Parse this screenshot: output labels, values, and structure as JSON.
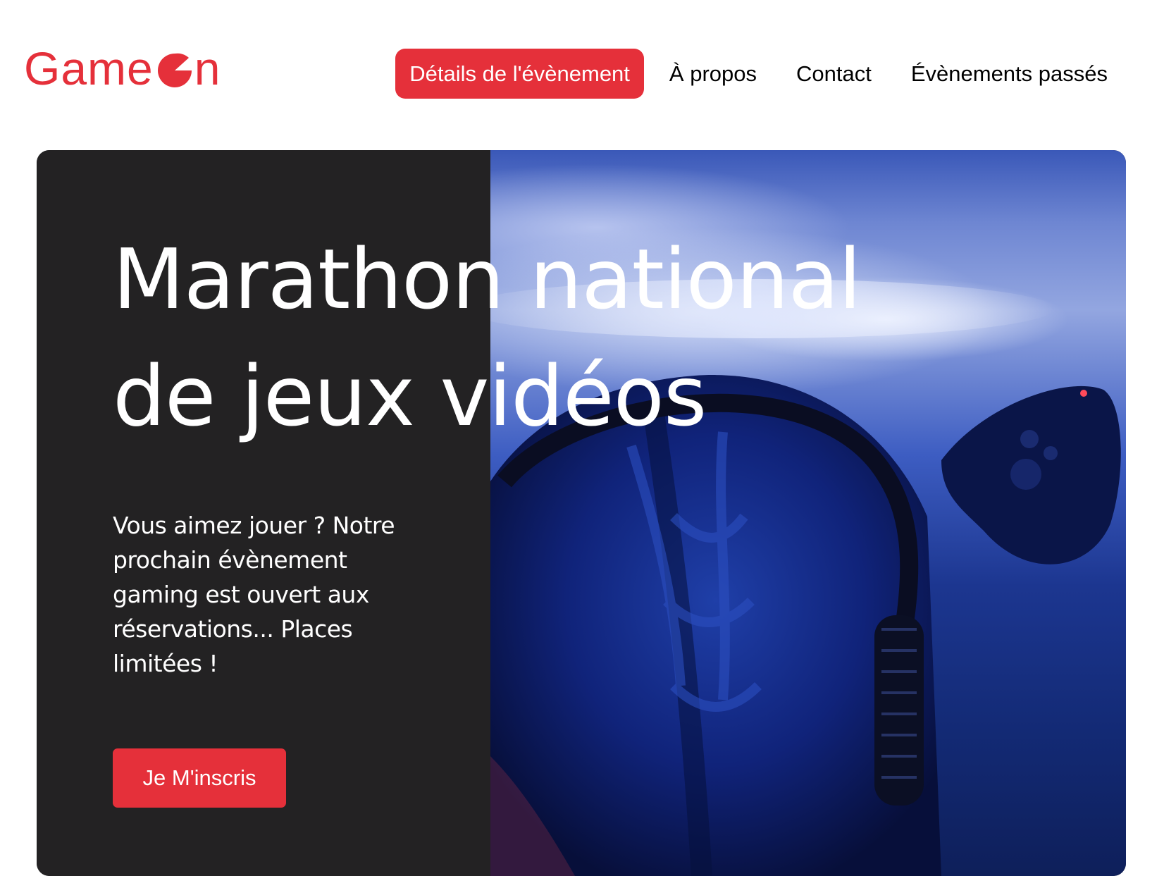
{
  "brand": {
    "name_prefix": "Game",
    "name_suffix": "n",
    "color": "#e5303a"
  },
  "nav": {
    "items": [
      {
        "label": "Détails de l'évènement",
        "active": true
      },
      {
        "label": "À propos",
        "active": false
      },
      {
        "label": "Contact",
        "active": false
      },
      {
        "label": "Évènements passés",
        "active": false
      }
    ]
  },
  "hero": {
    "title": "Marathon national de jeux vidéos",
    "text": "Vous aimez jouer ? Notre prochain évènement gaming est ouvert aux réservations... Places limitées !",
    "cta_label": "Je M'inscris",
    "image_icon": "gamer-headset-controller-photo"
  },
  "colors": {
    "accent": "#e5303a",
    "hero_panel": "#232223",
    "text_on_dark": "#ffffff"
  }
}
